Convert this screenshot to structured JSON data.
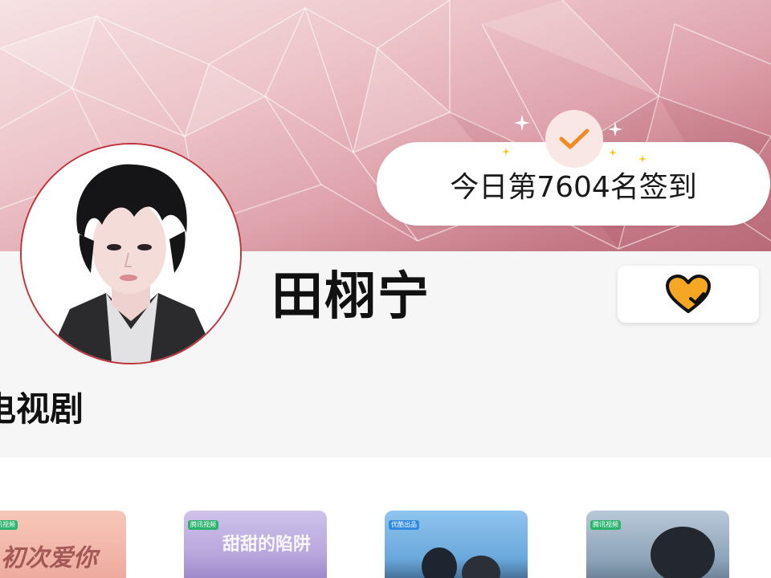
{
  "header": {
    "checkin_text": "今日第7604名签到"
  },
  "profile": {
    "name": "田栩宁",
    "follow_icon": "heart-check-icon"
  },
  "section": {
    "title": "电视剧"
  },
  "posters": [
    {
      "badge": "腾讯视频",
      "title": "初次爱你"
    },
    {
      "badge": "腾讯视频",
      "title": "甜甜的陷阱"
    },
    {
      "badge": "优酷出品",
      "title": ""
    },
    {
      "badge": "腾讯视频",
      "title": ""
    }
  ],
  "colors": {
    "accent_orange": "#f08b23",
    "heart_fill": "#f5a623",
    "avatar_border": "#c0343b"
  }
}
